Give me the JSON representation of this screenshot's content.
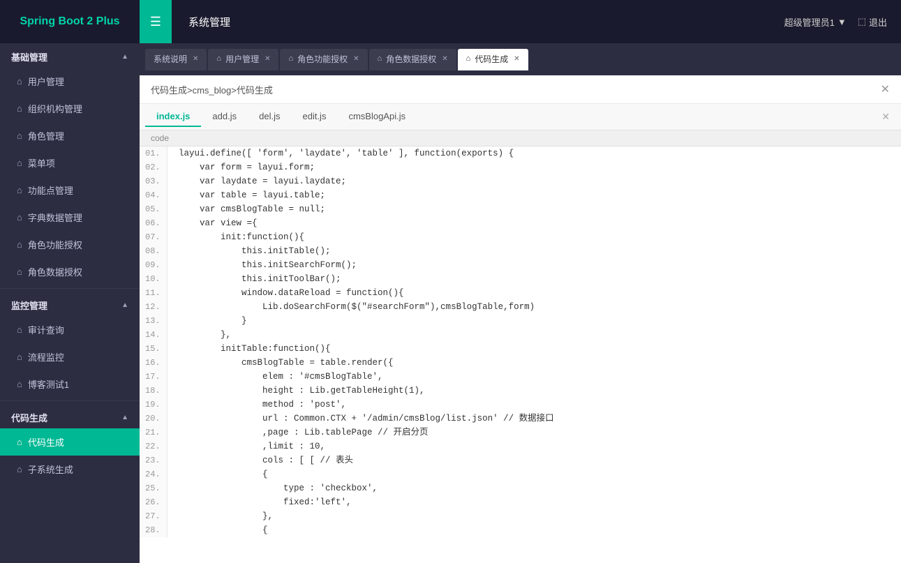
{
  "header": {
    "logo": "Spring Boot 2 Plus",
    "menu_icon": "☰",
    "system_title": "系统管理",
    "user_label": "超级管理员1",
    "user_arrow": "▼",
    "logout_icon": "⬚",
    "logout_label": "退出"
  },
  "sidebar": {
    "groups": [
      {
        "label": "基础管理",
        "arrow": "▲",
        "items": [
          {
            "label": "用户管理",
            "icon": "⌂"
          },
          {
            "label": "组织机构管理",
            "icon": "⌂"
          },
          {
            "label": "角色管理",
            "icon": "⌂"
          },
          {
            "label": "菜单项",
            "icon": "⌂"
          },
          {
            "label": "功能点管理",
            "icon": "⌂"
          },
          {
            "label": "字典数据管理",
            "icon": "⌂"
          },
          {
            "label": "角色功能授权",
            "icon": "⌂"
          },
          {
            "label": "角色数据授权",
            "icon": "⌂"
          }
        ]
      },
      {
        "label": "监控管理",
        "arrow": "▲",
        "items": [
          {
            "label": "审计查询",
            "icon": "⌂"
          },
          {
            "label": "流程监控",
            "icon": "⌂"
          },
          {
            "label": "博客测试1",
            "icon": "⌂"
          }
        ]
      },
      {
        "label": "代码生成",
        "arrow": "▲",
        "items": [
          {
            "label": "代码生成",
            "icon": "⌂",
            "active": true
          },
          {
            "label": "子系统生成",
            "icon": "⌂"
          }
        ]
      }
    ]
  },
  "tabs": [
    {
      "label": "系统说明",
      "closeable": true,
      "icon": ""
    },
    {
      "label": "用户管理",
      "closeable": true,
      "icon": "⌂"
    },
    {
      "label": "角色功能授权",
      "closeable": true,
      "icon": "⌂"
    },
    {
      "label": "角色数据授权",
      "closeable": true,
      "icon": "⌂"
    },
    {
      "label": "代码生成",
      "closeable": true,
      "icon": "⌂",
      "active": true
    }
  ],
  "breadcrumb": "代码生成>cms_blog>代码生成",
  "file_tabs": [
    {
      "label": "index.js",
      "active": true
    },
    {
      "label": "add.js"
    },
    {
      "label": "del.js"
    },
    {
      "label": "edit.js"
    },
    {
      "label": "cmsBlogApi.js"
    }
  ],
  "file_tabs_close": "✕",
  "code_header": "code",
  "code_lines": [
    {
      "num": "01.",
      "code": "layui.define([ 'form', 'laydate', 'table' ], function(exports) {"
    },
    {
      "num": "02.",
      "code": "    var form = layui.form;"
    },
    {
      "num": "03.",
      "code": "    var laydate = layui.laydate;"
    },
    {
      "num": "04.",
      "code": "    var table = layui.table;"
    },
    {
      "num": "05.",
      "code": "    var cmsBlogTable = null;"
    },
    {
      "num": "06.",
      "code": "    var view ={"
    },
    {
      "num": "07.",
      "code": "        init:function(){"
    },
    {
      "num": "08.",
      "code": "            this.initTable();"
    },
    {
      "num": "09.",
      "code": "            this.initSearchForm();"
    },
    {
      "num": "10.",
      "code": "            this.initToolBar();"
    },
    {
      "num": "11.",
      "code": "            window.dataReload = function(){"
    },
    {
      "num": "12.",
      "code": "                Lib.doSearchForm($(\"#searchForm\"),cmsBlogTable,form)"
    },
    {
      "num": "13.",
      "code": "            }"
    },
    {
      "num": "14.",
      "code": "        },"
    },
    {
      "num": "15.",
      "code": "        initTable:function(){"
    },
    {
      "num": "16.",
      "code": "            cmsBlogTable = table.render({"
    },
    {
      "num": "17.",
      "code": "                elem : '#cmsBlogTable',"
    },
    {
      "num": "18.",
      "code": "                height : Lib.getTableHeight(1),"
    },
    {
      "num": "19.",
      "code": "                method : 'post',"
    },
    {
      "num": "20.",
      "code": "                url : Common.CTX + '/admin/cmsBlog/list.json' // 数据接口"
    },
    {
      "num": "21.",
      "code": "                ,page : Lib.tablePage // 开启分页"
    },
    {
      "num": "22.",
      "code": "                ,limit : 10,"
    },
    {
      "num": "23.",
      "code": "                cols : [ [ // 表头"
    },
    {
      "num": "24.",
      "code": "                {"
    },
    {
      "num": "25.",
      "code": "                    type : 'checkbox',"
    },
    {
      "num": "26.",
      "code": "                    fixed:'left',"
    },
    {
      "num": "27.",
      "code": "                },"
    },
    {
      "num": "28.",
      "code": "                {"
    }
  ]
}
